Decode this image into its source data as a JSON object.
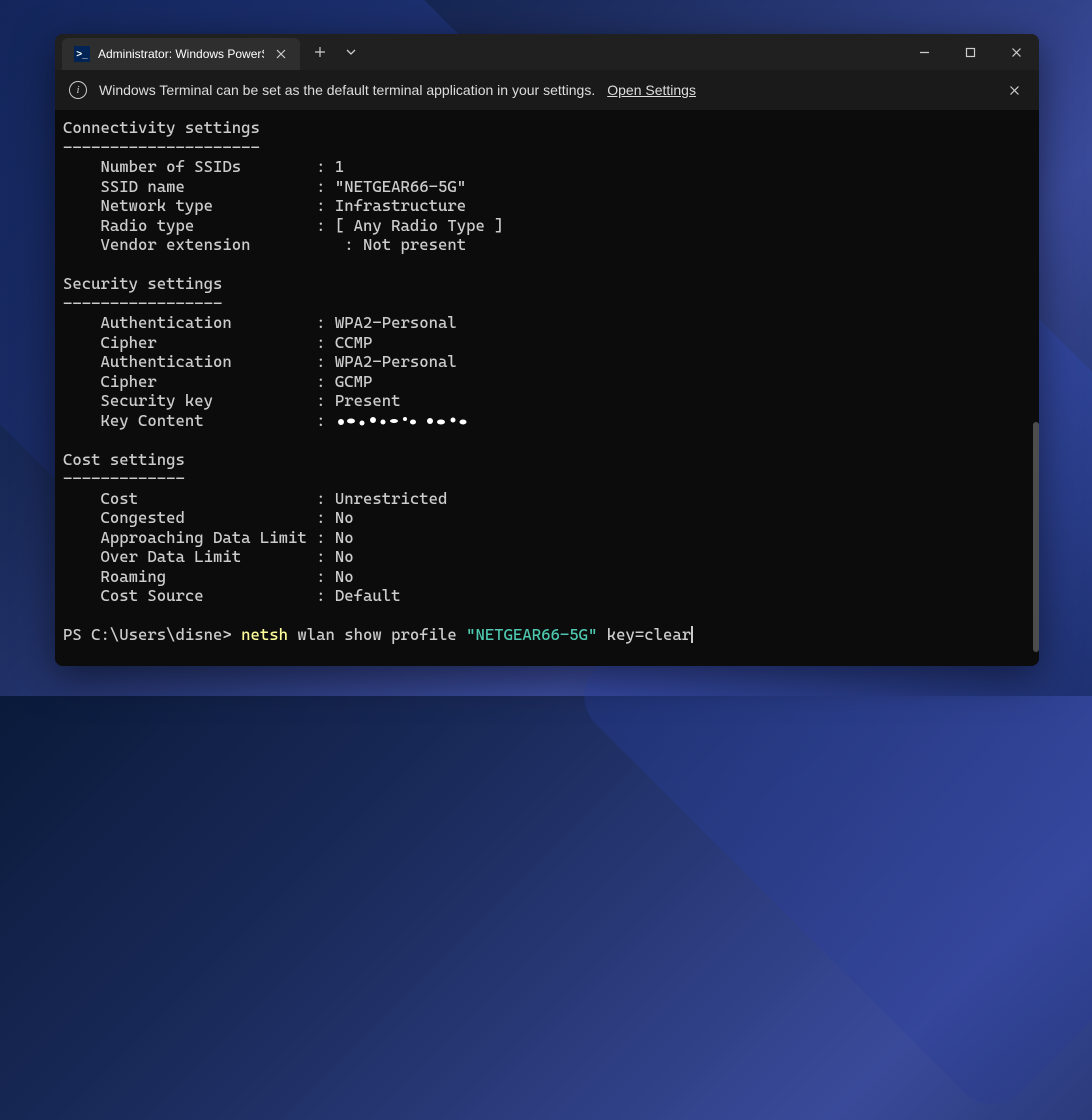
{
  "tab": {
    "title": "Administrator: Windows PowerS",
    "icon_label": "PS"
  },
  "notification": {
    "message": "Windows Terminal can be set as the default terminal application in your settings.",
    "link_label": "Open Settings"
  },
  "output": {
    "sections": [
      {
        "title": "Connectivity settings",
        "divider": "---------------------",
        "lines": [
          "    Number of SSIDs        : 1",
          "    SSID name              : \"NETGEAR66-5G\"",
          "    Network type           : Infrastructure",
          "    Radio type             : [ Any Radio Type ]",
          "    Vendor extension          : Not present"
        ]
      },
      {
        "title": "Security settings",
        "divider": "-----------------",
        "lines": [
          "    Authentication         : WPA2-Personal",
          "    Cipher                 : CCMP",
          "    Authentication         : WPA2-Personal",
          "    Cipher                 : GCMP",
          "    Security key           : Present",
          "    Key Content            : "
        ],
        "has_redacted": true
      },
      {
        "title": "Cost settings",
        "divider": "-------------",
        "lines": [
          "    Cost                   : Unrestricted",
          "    Congested              : No",
          "    Approaching Data Limit : No",
          "    Over Data Limit        : No",
          "    Roaming                : No",
          "    Cost Source            : Default"
        ]
      }
    ]
  },
  "prompt": {
    "ps": "PS ",
    "path": "C:\\Users\\disne> ",
    "cmd": "netsh",
    "args_plain1": " wlan show profile ",
    "args_string": "\"NETGEAR66-5G\"",
    "args_plain2": " key=clear"
  }
}
